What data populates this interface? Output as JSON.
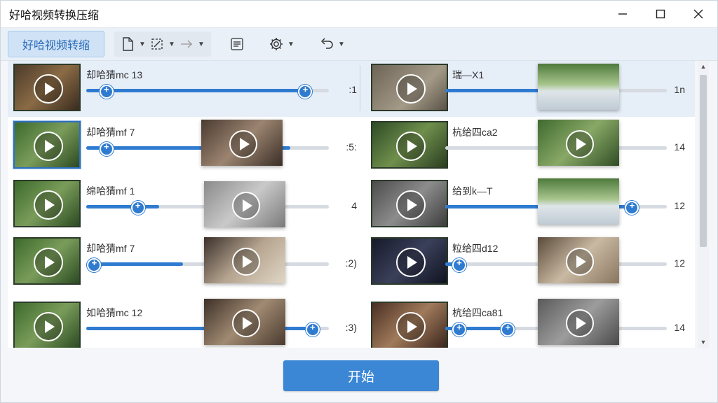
{
  "app": {
    "title": "好哈视频转换压缩",
    "window_controls": [
      "minimize-icon",
      "maximize-icon",
      "close-icon"
    ]
  },
  "toolbar": {
    "main_label": "好哈视频转缩",
    "icons": [
      "file-icon",
      "crop-icon",
      "split-icon",
      "list-icon",
      "gear-icon",
      "undo-icon"
    ]
  },
  "left_items": [
    {
      "name": "却哈猜mc 13",
      "value": ":1",
      "selected_row": true
    },
    {
      "name": "却哈猜mf 7",
      "value": ":5:",
      "selected_thumb": true
    },
    {
      "name": "绵哈猜mf 1",
      "value": "4"
    },
    {
      "name": "却哈猜mf 7",
      "value": ":2)"
    },
    {
      "name": "如哈猜mc 12",
      "value": ":3)"
    }
  ],
  "right_items": [
    {
      "name": "瑞—X1",
      "value": "1n"
    },
    {
      "name": "杭给四ca2",
      "value": "14"
    },
    {
      "name": "给到k—T",
      "value": "12"
    },
    {
      "name": "粒给四d12",
      "value": "12"
    },
    {
      "name": "杭给四ca81",
      "value": "14"
    }
  ],
  "footer": {
    "start_label": "开始"
  },
  "colors": {
    "accent": "#2f7bd0",
    "button": "#3b87d6",
    "toolbar_active": "#cfe2f6"
  }
}
